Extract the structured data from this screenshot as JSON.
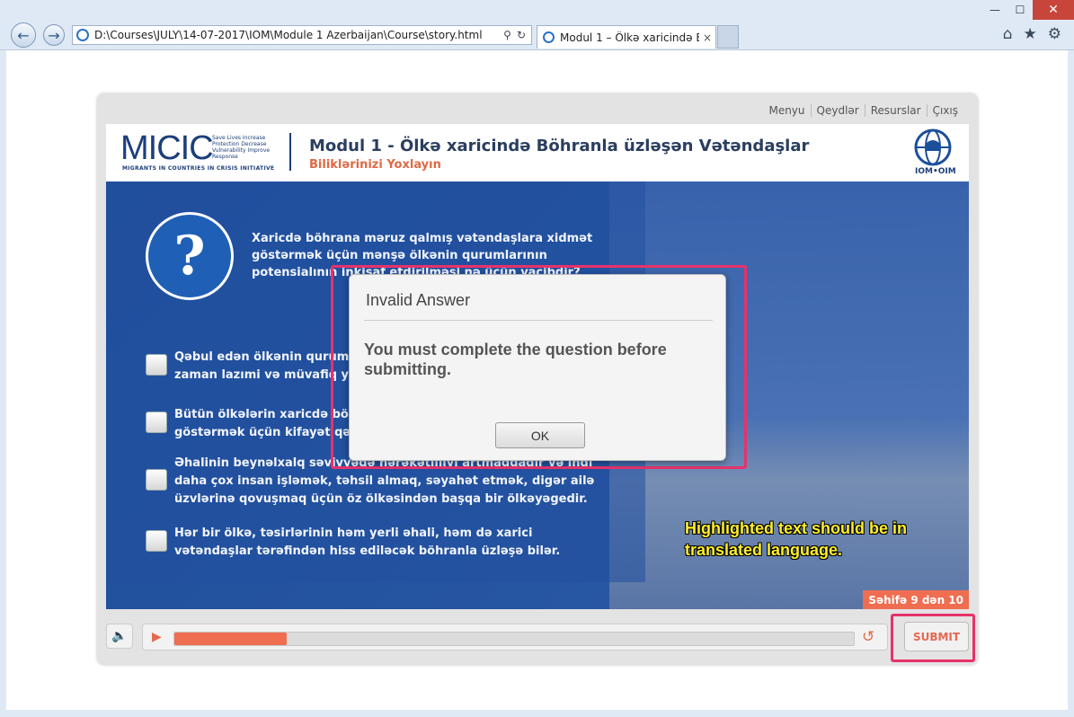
{
  "browser": {
    "address": "D:\\Courses\\JULY\\14-07-2017\\IOM\\Module 1 Azerbaijan\\Course\\story.html",
    "tab_title": "Modul 1 – Ölkə xaricində B...",
    "tab_close": "×",
    "back_icon": "←",
    "forward_icon": "→",
    "search_icon": "⚲",
    "refresh_icon": "↻",
    "min_icon": "—",
    "max_icon": "☐",
    "close_icon": "✕",
    "home_icon": "⌂",
    "fav_icon": "★",
    "settings_icon": "⚙"
  },
  "menu": {
    "items": [
      "Menyu",
      "Qeydlər",
      "Resurslar",
      "Çıxış"
    ]
  },
  "header": {
    "logo": "MICIC",
    "logo_tag": "Save Lives Increase Protection Decrease Vulnerability Improve Response",
    "logo_full": "MIGRANTS IN COUNTRIES IN CRISIS INITIATIVE",
    "title": "Modul 1 - Ölkə xaricində Böhranla üzləşən Vətəndaşlar",
    "subtitle": "Biliklərinizi Yoxlayın",
    "iom_label": "IOM•OIM"
  },
  "question": {
    "text": "Xaricdə böhrana məruz qalmış vətəndaşlara xidmət göstərmək üçün mənşə ölkənin qurumlarının potensialının inkişaf etdirilməsi nə üçün vacibdir?",
    "icon": "?",
    "options": [
      "Qəbul edən ölkənin qurumları potensialının inkişaf etdirilməsi hər zaman lazımi və müvafiq yardım təmin edə bilmir.",
      "Bütün ölkələrin xaricdə böhranla üzləşən vətəndaşlarına xidmət göstərmək üçün kifayət qədər resursu var.",
      "Əhalinin beynəlxalq səviyyədə hərəkətliliyi artmaqdadır və indi daha çox insan işləmək, təhsil almaq, səyahət etmək, digər ailə üzvlərinə qovuşmaq üçün öz ölkəsindən başqa bir ölkəyəgedir.",
      "Hər bir ölkə, təsirlərinin həm yerli əhali, həm də xarici vətəndaşlar tərəfindən hiss ediləcək böhranla üzləşə bilər."
    ]
  },
  "page_indicator": "Səhifə 9 dən 10",
  "annotation": "Highlighted text should be in translated language.",
  "controls": {
    "progress_fraction": 0.165,
    "submit_label": "SUBMIT",
    "volume_icon": "🔈",
    "play_icon": "▶",
    "replay_icon": "↺"
  },
  "dialog": {
    "title": "Invalid Answer",
    "message": "You must complete the question before submitting.",
    "ok_label": "OK"
  },
  "colors": {
    "accent": "#ef6d51",
    "highlight": "#e8326a",
    "annotation": "#ffef2a"
  }
}
